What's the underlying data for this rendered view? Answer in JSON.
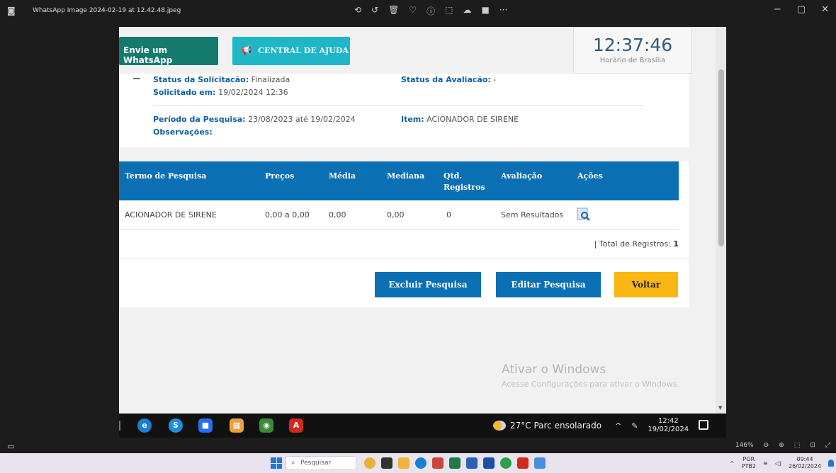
{
  "viewer": {
    "title": "WhatsApp Image 2024-02-19 at 12.42.48.jpeg",
    "tools": [
      "⟲",
      "↺",
      "🗑",
      "♡",
      "ⓘ",
      "⬚",
      "☁",
      "■",
      "···"
    ],
    "window_controls": [
      "−",
      "▢",
      "✕"
    ],
    "zoom": "146%",
    "bottom_icons": [
      "⊖",
      "⊕",
      "⬚",
      "⊡",
      "⤢"
    ]
  },
  "header": {
    "whatsapp_label": "Envie um WhatsApp",
    "help_label": "CENTRAL DE AJUDA",
    "clock_time": "12:37:46",
    "clock_zone": "Horário de Brasília"
  },
  "request": {
    "status_label": "Status da Solicitação:",
    "status_value": "Finalizada",
    "eval_label": "Status da Avaliação:",
    "eval_value": "-",
    "requested_label": "Solicitado em:",
    "requested_value": "19/02/2024 12:36",
    "period_label": "Período da Pesquisa:",
    "period_value": "23/08/2023 até 19/02/2024",
    "item_label": "Item:",
    "item_value": "ACIONADOR DE SIRENE",
    "obs_label": "Observações:"
  },
  "table": {
    "headers": [
      "Termo de Pesquisa",
      "Preços",
      "Média",
      "Mediana",
      "Qtd. Registros",
      "Avaliação",
      "Ações"
    ],
    "rows": [
      {
        "term": "ACIONADOR DE SIRENE",
        "prices": "0,00 a 0,00",
        "mean": "0,00",
        "median": "0,00",
        "count": "0",
        "evaluation": "Sem Resultados"
      }
    ],
    "total_label": "| Total de Registros:",
    "total_value": "1"
  },
  "actions": {
    "delete": "Excluir Pesquisa",
    "edit": "Editar Pesquisa",
    "back": "Voltar"
  },
  "watermark": {
    "line1": "Ativar o Windows",
    "line2": "Acesse Configurações para ativar o Windows."
  },
  "inner_taskbar": {
    "weather": "27°C  Parc ensolarado",
    "time": "12:42",
    "date": "19/02/2024"
  },
  "taskbar": {
    "search_placeholder": "Pesquisar",
    "lang": "POR",
    "lang2": "PTB2",
    "time": "09:44",
    "date": "26/02/2024"
  }
}
